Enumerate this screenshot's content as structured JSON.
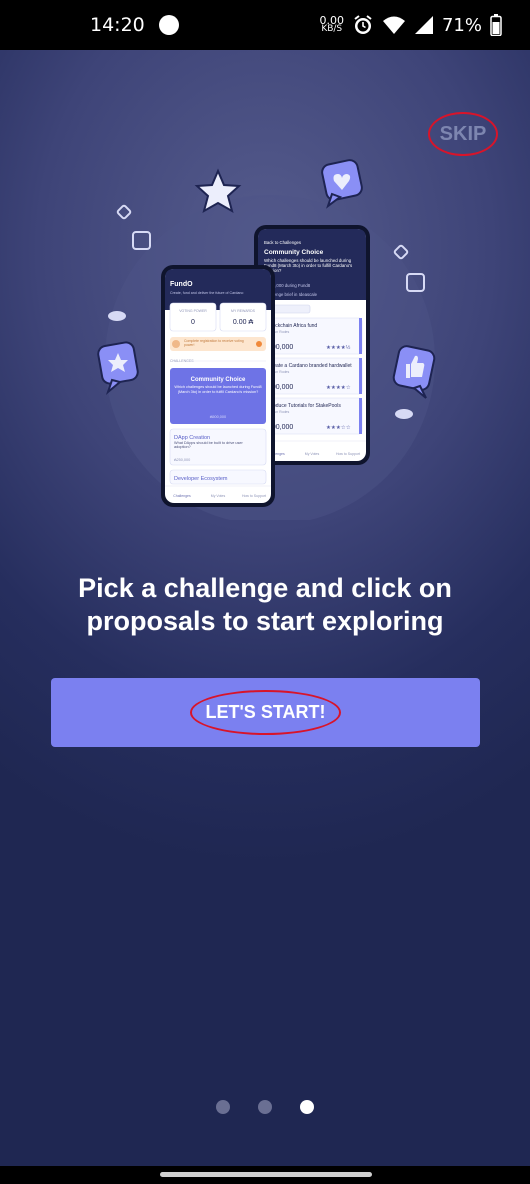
{
  "status_bar": {
    "time": "14:20",
    "net_speed_value": "0.00",
    "net_speed_unit": "KB/S",
    "battery": "71%"
  },
  "skip": {
    "label": "SKIP"
  },
  "headline": "Pick a challenge and click on proposals to start exploring",
  "start_button": {
    "label": "LET'S START!"
  },
  "pagination": {
    "total": 3,
    "current": 3
  },
  "phone_front": {
    "app_name": "FundO",
    "tagline": "Create, fund and deliver the future of Cardano",
    "voting_power_label": "VOTING POWER",
    "voting_power_value": "0",
    "rewards_label": "MY REWARDS",
    "rewards_value": "0.00 ₳",
    "banner_text": "Complete registration to receive voting power!",
    "challenges_label": "CHALLENGES",
    "card_title": "Community Choice",
    "card_text": "Which challenges should be launched during Fund8 (March 3to) in order to fulfill Cardano's mission?",
    "card_amount": "₳500,000",
    "item1_title": "DApp Creation",
    "item1_text": "What DApps should be built to drive user adoption?",
    "item1_amount": "₳250,000",
    "item2_title": "Developer Ecosystem",
    "tabs": [
      "Challenges",
      "My Votes",
      "How to Support"
    ]
  },
  "phone_back": {
    "back_link": "Back to Challenges",
    "title": "Community Choice",
    "subtitle": "Which challenges should be launched during Fund8 (March 3to) in order to fulfill Cardano's mission?",
    "funds": "₳ 500,000 during Fund8",
    "brief_link": "Challenge brief in Ideascale",
    "proposals": [
      {
        "title": "Blockchain Africa fund",
        "author": "Shaun Rodes",
        "amount": "000,000"
      },
      {
        "title": "Create a Cardano branded hardwallet",
        "author": "Shaun Rodes",
        "amount": "000,000"
      },
      {
        "title": "Produce Tutorials for StakePools",
        "author": "Shaun Rodes",
        "amount": "000,000"
      }
    ],
    "tabs": [
      "Challenges",
      "My Votes",
      "How to Support"
    ]
  },
  "colors": {
    "accent": "#7b80f0",
    "annotation": "#d8142a",
    "background_top": "#565c8d",
    "background_bottom": "#1f2752"
  },
  "icons": [
    "star-icon",
    "heart-bubble-icon",
    "star-bubble-icon",
    "thumbs-up-bubble-icon",
    "alarm-icon",
    "wifi-icon",
    "signal-icon",
    "battery-icon"
  ]
}
